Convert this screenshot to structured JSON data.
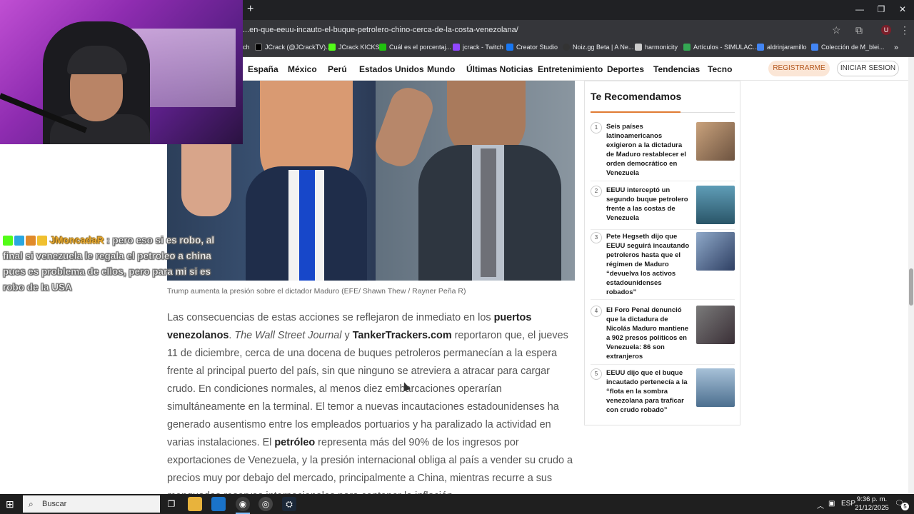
{
  "browser": {
    "url": "...en-que-eeuu-incauto-el-buque-petrolero-chino-cerca-de-la-costa-venezolana/",
    "new_tab": "+",
    "bookmarks": [
      {
        "label": "ch",
        "color": "#9147ff"
      },
      {
        "label": "JCrack (@JCrackTV)...",
        "color": "#000000"
      },
      {
        "label": "JCrack KICKS",
        "color": "#53fc18"
      },
      {
        "label": "Cuál es el porcentaj...",
        "color": "#20c20e"
      },
      {
        "label": "jcrack - Twitch",
        "color": "#9147ff"
      },
      {
        "label": "Creator Studio",
        "color": "#1877f2"
      },
      {
        "label": "Noiz.gg Beta | A Ne...",
        "color": "#333333"
      },
      {
        "label": "harmonicity",
        "color": "#cccccc"
      },
      {
        "label": "Artículos - SIMULAC...",
        "color": "#34a853"
      },
      {
        "label": "aldrinjaramillo",
        "color": "#4285f4"
      },
      {
        "label": "Colección de M_blei...",
        "color": "#4285f4"
      }
    ]
  },
  "site": {
    "nav": [
      "España",
      "México",
      "Perú",
      "Estados Unidos",
      "Mundo",
      "Últimas Noticias",
      "Entretenimiento",
      "Deportes",
      "Tendencias",
      "Tecno"
    ],
    "register": "REGISTRARME",
    "login": "INICIAR SESION"
  },
  "article": {
    "caption": "Trump aumenta la presión sobre el dictador Maduro (EFE/ Shawn Thew / Rayner Peña R)",
    "p1_a": "Las consecuencias de estas acciones se reflejaron de inmediato en los ",
    "p1_b": "puertos venezolanos",
    "p1_c": ". ",
    "p1_d": "The Wall Street Journal",
    "p1_e": " y ",
    "p1_f": "TankerTrackers.com",
    "p1_g": " reportaron que, el jueves 11 de diciembre, cerca de una docena de buques petroleros permanecían a la espera frente al principal puerto del país, sin que ninguno se atreviera a atracar para cargar crudo. En condiciones normales, al menos diez embarcaciones operarían simultáneamente en la terminal. El temor a nuevas incautaciones estadounidenses ha generado ausentismo entre los empleados portuarios y ha paralizado la actividad en varias instalaciones. El ",
    "p1_h": "petróleo",
    "p1_i": " representa más del 90% de los ingresos por exportaciones de Venezuela, y la presión internacional obliga al país a vender su crudo a precios muy por debajo del mercado, principalmente a China, mientras recurre a sus menguadas reservas internacionales para contener la inflación."
  },
  "sidebar": {
    "title": "Te Recomendamos",
    "items": [
      {
        "num": "1",
        "text": "Seis países latinoamericanos exigieron a la dictadura de Maduro restablecer el orden democrático en Venezuela",
        "thumb": "#8a6a4e"
      },
      {
        "num": "2",
        "text": "EEUU interceptó un segundo buque petrolero frente a las costas de Venezuela",
        "thumb": "#3f6f86"
      },
      {
        "num": "3",
        "text": "Pete Hegseth dijo que EEUU seguirá incautando petroleros hasta que el régimen de Maduro “devuelva los activos estadounidenses robados”",
        "thumb": "#3d4f72"
      },
      {
        "num": "4",
        "text": "El Foro Penal denunció que la dictadura de Nicolás Maduro mantiene a 902 presos políticos en Venezuela: 86 son extranjeros",
        "thumb": "#5a5a5a"
      },
      {
        "num": "5",
        "text": "EEUU dijo que el buque incautado pertenecía a la “flota en la sombra venezolana para traficar con crudo robado”",
        "thumb": "#6d8fae"
      }
    ]
  },
  "stream": {
    "chat_user": "JMoncadaR",
    "chat_sep": " : ",
    "chat_message": "pero eso si es robo, al final si venezuela le regala el petroleo a china pues es problema de ellos, pero para mi si es robo de la USA"
  },
  "taskbar": {
    "search": "Buscar",
    "lang": "ESP",
    "time": "9:36 p. m.",
    "date": "21/12/2025",
    "notifications": "5"
  }
}
